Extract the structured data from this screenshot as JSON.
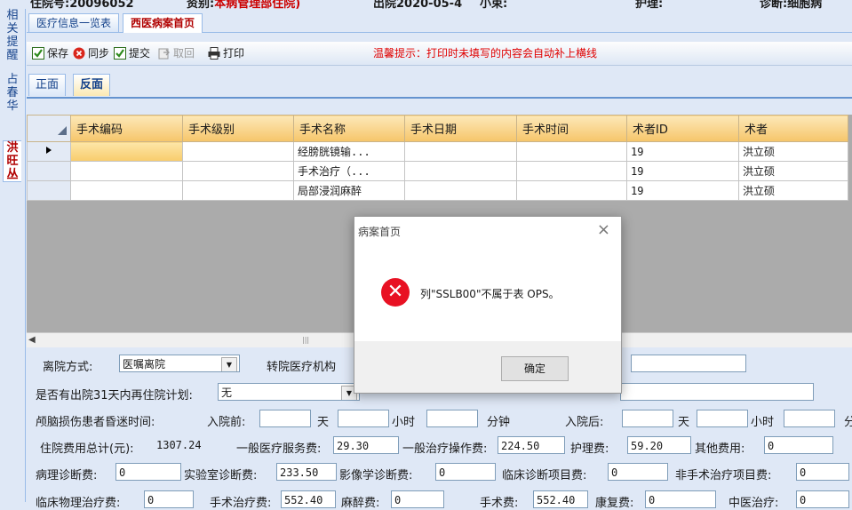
{
  "top": {
    "admission_label": "住院号:",
    "admission_value": "20096052",
    "dept_label": "资别:",
    "dept_value": "本病管理部住院)",
    "date_text": "出院2020-05-4",
    "end_text": "小束:",
    "nurse_label": "护理:",
    "diag_label": "诊断:",
    "diag_value": "细胞病"
  },
  "left_tabs": [
    {
      "label": "相关提醒",
      "active": false
    },
    {
      "label": "占春华",
      "active": false
    },
    {
      "label": "洪旺丛",
      "active": true
    }
  ],
  "outer_tabs": [
    {
      "label": "医疗信息一览表",
      "active": false
    },
    {
      "label": "西医病案首页",
      "active": true
    }
  ],
  "toolbar": {
    "save": "保存",
    "sync": "同步",
    "submit": "提交",
    "retrieve": "取回",
    "print": "打印",
    "tip": "温馨提示：打印时未填写的内容会自动补上横线"
  },
  "inner_tabs": [
    {
      "label": "正面",
      "active": false
    },
    {
      "label": "反面",
      "active": true
    }
  ],
  "grid": {
    "columns": [
      "手术编码",
      "手术级别",
      "手术名称",
      "手术日期",
      "手术时间",
      "术者ID",
      "术者"
    ],
    "rows": [
      [
        "",
        "",
        "经膀胱镜输...",
        "",
        "",
        "19",
        "洪立硕"
      ],
      [
        "",
        "",
        "手术治疗（...",
        "",
        "",
        "19",
        "洪立硕"
      ],
      [
        "",
        "",
        "局部浸润麻醉",
        "",
        "",
        "19",
        "洪立硕"
      ]
    ]
  },
  "form": {
    "discharge_label": "离院方式:",
    "discharge_value": "医嘱离院",
    "transfer_label": "转院医疗机构",
    "readmit_label": "是否有出院31天内再住院计划:",
    "readmit_value": "无",
    "coma_label": "颅脑损伤患者昏迷时间:",
    "before_label": "入院前:",
    "after_label": "入院后:",
    "day": "天",
    "hour": "小时",
    "minute": "分钟",
    "minute_cut": "分",
    "total_label": "住院费用总计(元):",
    "total_value": "1307.24",
    "general_service_label": "一般医疗服务费:",
    "general_service_value": "29.30",
    "general_treat_label": "一般治疗操作费:",
    "general_treat_value": "224.50",
    "nursing_label": "护理费:",
    "nursing_value": "59.20",
    "other_label": "其他费用:",
    "other_value": "0",
    "pathology_label": "病理诊断费:",
    "pathology_value": "0",
    "lab_label": "实验室诊断费:",
    "lab_value": "233.50",
    "imaging_label": "影像学诊断费:",
    "imaging_value": "0",
    "clinical_label": "临床诊断项目费:",
    "clinical_value": "0",
    "nonsurg_label": "非手术治疗项目费:",
    "nonsurg_value": "0",
    "row6_label1": "临床物理治疗费:",
    "row6_value1": "0",
    "row6_label2": "手术治疗费:",
    "row6_value2": "552.40",
    "row6_label3": "麻醉费:",
    "row6_value3": "0",
    "row6_label4": "手术费:",
    "row6_value4": "552.40",
    "row6_label5": "康复费:",
    "row6_value5": "0",
    "row6_label6": "中医治疗:",
    "row6_value6": "0"
  },
  "dialog": {
    "title": "病案首页",
    "message": "列\"SSLB00\"不属于表 OPS。",
    "ok": "确定"
  }
}
